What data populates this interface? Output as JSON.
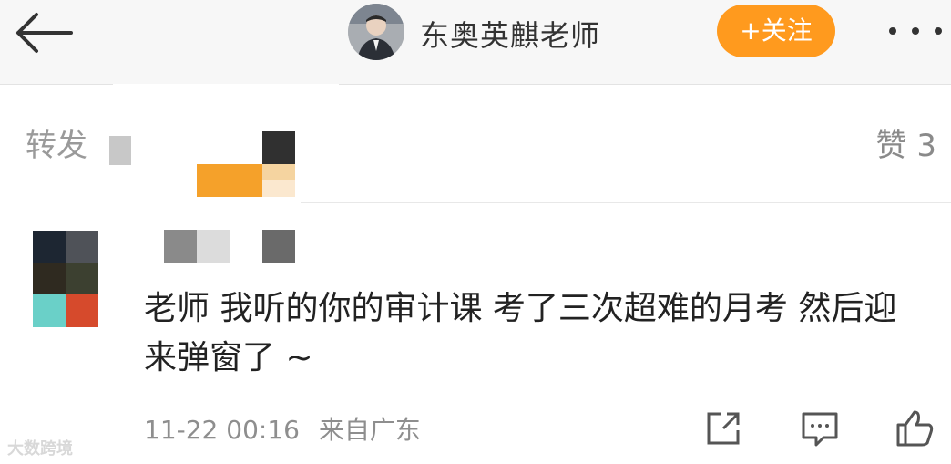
{
  "header": {
    "author_name": "东奥英麒老师",
    "follow_label": "+关注",
    "icons": {
      "back": "back-arrow-icon",
      "more": "more-dots-icon"
    }
  },
  "tabs": {
    "repost_label": "转发",
    "like_label": "赞 3"
  },
  "comment": {
    "text": "老师 我听的你的审计课 考了三次超难的月考 然后迎来弹窗了 ~",
    "date": "11-22 00:16",
    "location": "来自广东",
    "actions": [
      "share-icon",
      "comment-icon",
      "like-icon"
    ]
  },
  "watermark": "大数跨境",
  "colors": {
    "accent": "#ff9a1e",
    "header_bg": "#f7f7f7",
    "muted": "#8e8e8e"
  }
}
